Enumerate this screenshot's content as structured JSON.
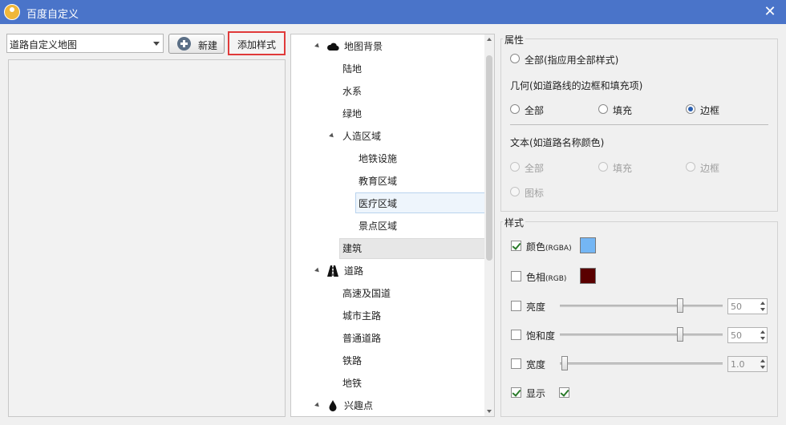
{
  "window": {
    "title": "百度自定义"
  },
  "toolbar": {
    "map_select_value": "道路自定义地图",
    "new_label": "新建",
    "add_style_label": "添加样式"
  },
  "tree": {
    "items": [
      {
        "label": "地图背景",
        "icon": "cloud-icon"
      },
      {
        "label": "陆地"
      },
      {
        "label": "水系"
      },
      {
        "label": "绿地"
      },
      {
        "label": "人造区域"
      },
      {
        "label": "地铁设施"
      },
      {
        "label": "教育区域"
      },
      {
        "label": "医疗区域"
      },
      {
        "label": "景点区域"
      },
      {
        "label": "建筑"
      },
      {
        "label": "道路",
        "icon": "road-icon"
      },
      {
        "label": "高速及国道"
      },
      {
        "label": "城市主路"
      },
      {
        "label": "普通道路"
      },
      {
        "label": "铁路"
      },
      {
        "label": "地铁"
      },
      {
        "label": "兴趣点",
        "icon": "drop-icon"
      }
    ],
    "highlighted": "医疗区域",
    "selected": "建筑"
  },
  "properties": {
    "title": "属性",
    "all_label": "全部(指应用全部样式)",
    "geometry_title": "几何(如道路线的边框和填充项)",
    "geometry_options": [
      "全部",
      "填充",
      "边框"
    ],
    "geometry_selected": "边框",
    "text_title": "文本(如道路名称颜色)",
    "text_options": [
      "全部",
      "填充",
      "边框",
      "图标"
    ]
  },
  "style": {
    "title": "样式",
    "color": {
      "label": "颜色",
      "suffix": "(RGBA)",
      "checked": true,
      "value": "#74b6f4"
    },
    "hue": {
      "label": "色相",
      "suffix": "(RGB)",
      "checked": false,
      "value": "#5a0000"
    },
    "brightness": {
      "label": "亮度",
      "checked": false,
      "value": "50"
    },
    "saturation": {
      "label": "饱和度",
      "checked": false,
      "value": "50"
    },
    "width": {
      "label": "宽度",
      "checked": false,
      "value": "1.0"
    },
    "visible": {
      "label": "显示",
      "checked": true
    }
  }
}
